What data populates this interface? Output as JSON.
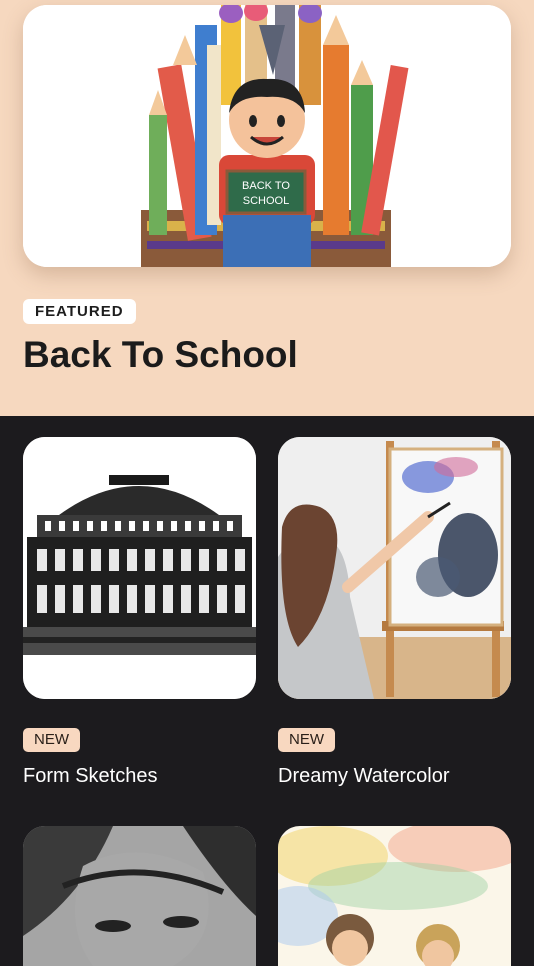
{
  "featured": {
    "badge": "FEATURED",
    "title": "Back To School",
    "hero_image": "back-to-school-illustration",
    "hero_sign_text": [
      "BACK TO",
      "SCHOOL"
    ]
  },
  "collections": [
    {
      "badge": "NEW",
      "title": "Form Sketches",
      "image": "royal-albert-hall-sketch"
    },
    {
      "badge": "NEW",
      "title": "Dreamy Watercolor",
      "image": "painter-at-easel-photo"
    },
    {
      "image": "charcoal-portrait-sketch"
    },
    {
      "image": "watercolor-figures-painting"
    }
  ],
  "colors": {
    "featured_bg": "#f6d8bf",
    "grid_bg": "#1c1b1e",
    "new_badge_bg": "#f8d8c0"
  }
}
